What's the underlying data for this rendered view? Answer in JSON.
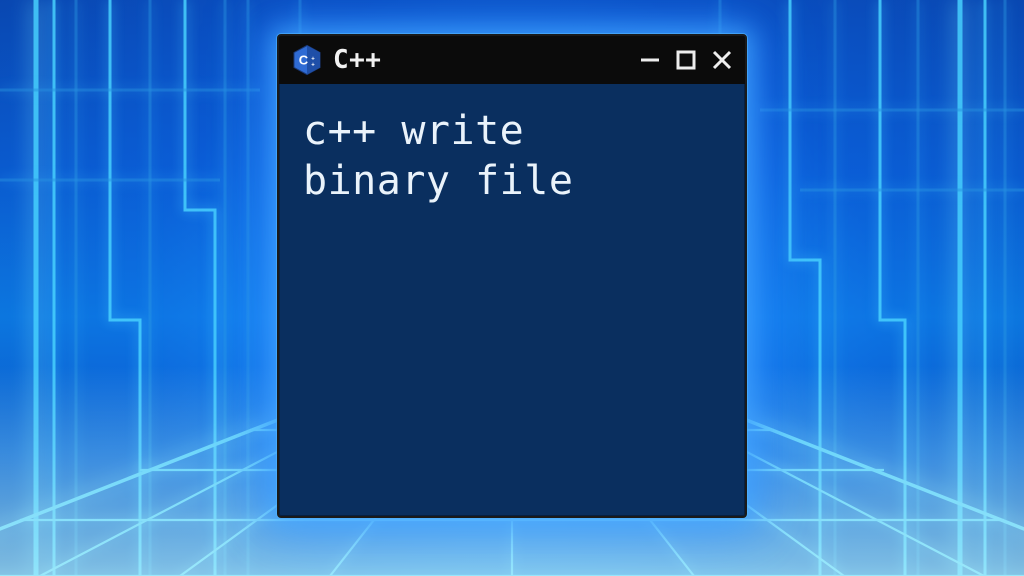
{
  "window": {
    "title": "C++",
    "icon_name": "cpp-icon",
    "content_text": "c++ write\nbinary file"
  },
  "colors": {
    "window_bg": "#0a2f5f",
    "titlebar_bg": "#0b0b0b",
    "accent_blue": "#2f6bd4",
    "text": "#eaf3fb"
  }
}
